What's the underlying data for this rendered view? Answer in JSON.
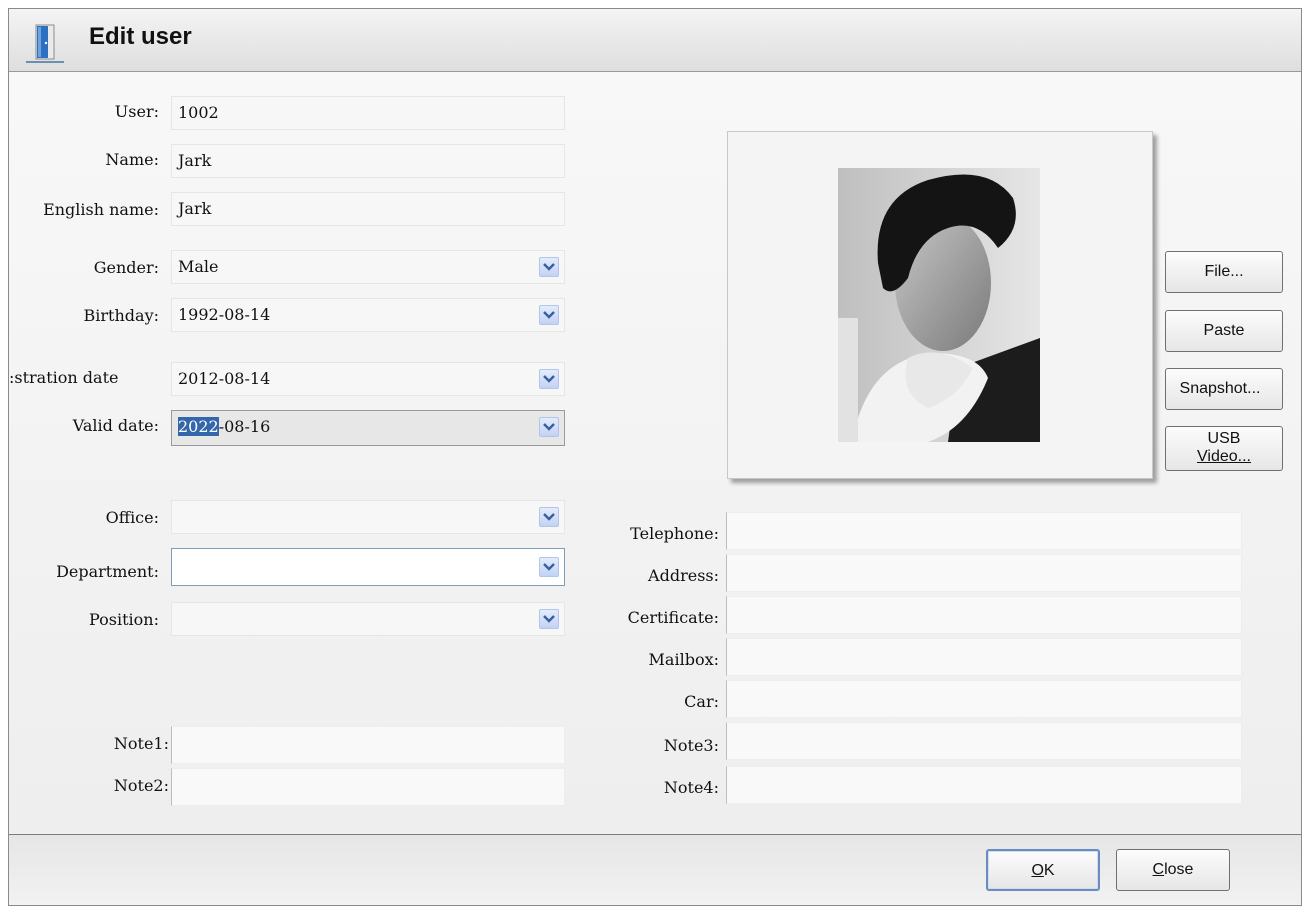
{
  "window": {
    "title": "Edit user"
  },
  "form": {
    "user": {
      "label": "User:",
      "value": "1002"
    },
    "name": {
      "label": "Name:",
      "value": "Jark"
    },
    "english_name": {
      "label": "English name:",
      "value": "Jark"
    },
    "gender": {
      "label": "Gender:",
      "value": "Male"
    },
    "birthday": {
      "label": "Birthday:",
      "value": "1992-08-14"
    },
    "registration_date": {
      "label": "stration date:",
      "value": "2012-08-14"
    },
    "valid_date": {
      "label": "Valid date:",
      "value_selected": "2022",
      "value_rest": "-08-16"
    },
    "office": {
      "label": "Office:",
      "value": ""
    },
    "department": {
      "label": "Department:",
      "value": ""
    },
    "position": {
      "label": "Position:",
      "value": ""
    },
    "note1": {
      "label": "Note1:",
      "value": ""
    },
    "note2": {
      "label": "Note2:",
      "value": ""
    },
    "telephone": {
      "label": "Telephone:",
      "value": ""
    },
    "address": {
      "label": "Address:",
      "value": ""
    },
    "certificate": {
      "label": "Certificate:",
      "value": ""
    },
    "mailbox": {
      "label": "Mailbox:",
      "value": ""
    },
    "car": {
      "label": "Car:",
      "value": ""
    },
    "note3": {
      "label": "Note3:",
      "value": ""
    },
    "note4": {
      "label": "Note4:",
      "value": ""
    }
  },
  "photo_buttons": {
    "file": "File...",
    "paste": "Paste",
    "snapshot": "Snapshot...",
    "usb_video_line1": "USB",
    "usb_video_line2": "Video..."
  },
  "footer": {
    "ok_mnemonic": "O",
    "ok_rest": "K",
    "close_mnemonic": "C",
    "close_rest": "lose"
  },
  "colors": {
    "selection": "#3366aa",
    "dropdown_button": "#c1d3f4",
    "title_bar": "#dedede"
  },
  "icons": {
    "window": "door-icon",
    "dropdown": "chevron-down-icon",
    "photo": "user-portrait"
  }
}
